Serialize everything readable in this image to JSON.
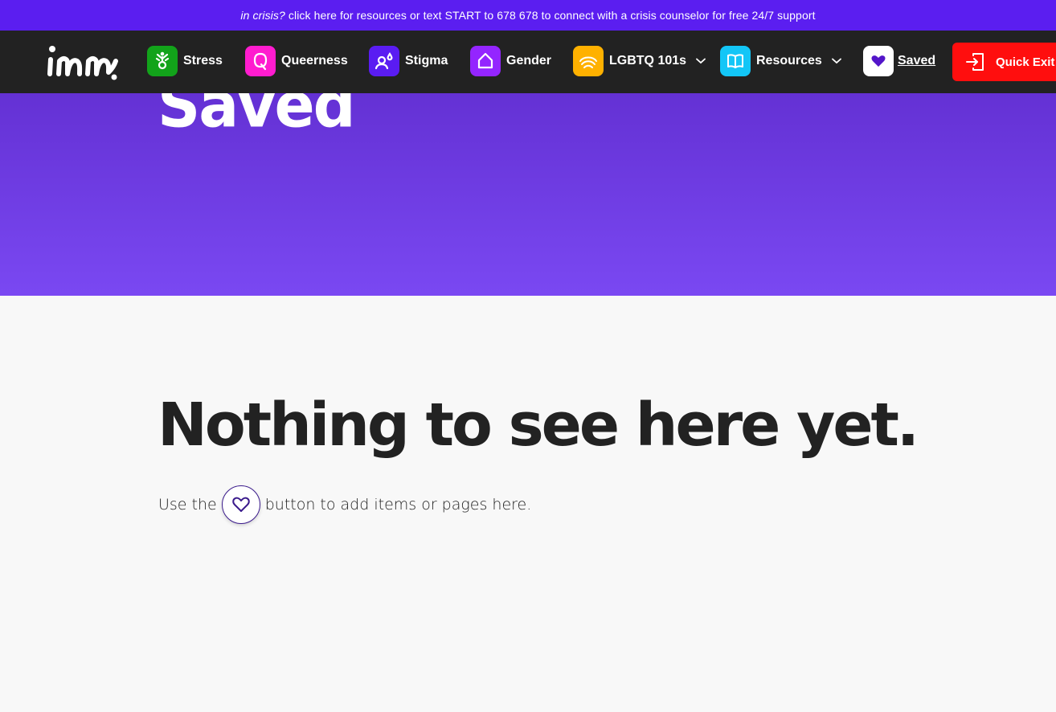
{
  "crisis_banner": {
    "prefix": "in crisis?",
    "text": "click here for resources or text START to 678 678 to connect with a crisis counselor for free 24/7 support"
  },
  "nav": {
    "logo_alt": "imi",
    "items": [
      {
        "label": "Stress",
        "icon": "sprout-icon",
        "color": "#12a31a"
      },
      {
        "label": "Queerness",
        "icon": "q-letter-icon",
        "color": "#ff1ccf"
      },
      {
        "label": "Stigma",
        "icon": "person-drop-icon",
        "color": "#5a1cf2"
      },
      {
        "label": "Gender",
        "icon": "house-icon",
        "color": "#9425ff"
      },
      {
        "label": "LGBTQ 101s",
        "icon": "rainbow-icon",
        "color": "#ffb100",
        "dropdown": true
      },
      {
        "label": "Resources",
        "icon": "book-icon",
        "color": "#13c6f7",
        "dropdown": true
      },
      {
        "label": "Saved",
        "icon": "heart-icon",
        "color": "#ffffff"
      }
    ],
    "quick_exit": "Quick Exit"
  },
  "hero": {
    "title": "Saved"
  },
  "empty_state": {
    "heading": "Nothing to see here yet.",
    "text_before": "Use the",
    "text_after": "button to add items or pages here."
  },
  "colors": {
    "banner": "#5b1ef0",
    "nav_bg": "#222222",
    "hero_top": "#6431d4",
    "hero_bottom": "#7a48f2",
    "quick_exit": "#ff0e0e"
  }
}
